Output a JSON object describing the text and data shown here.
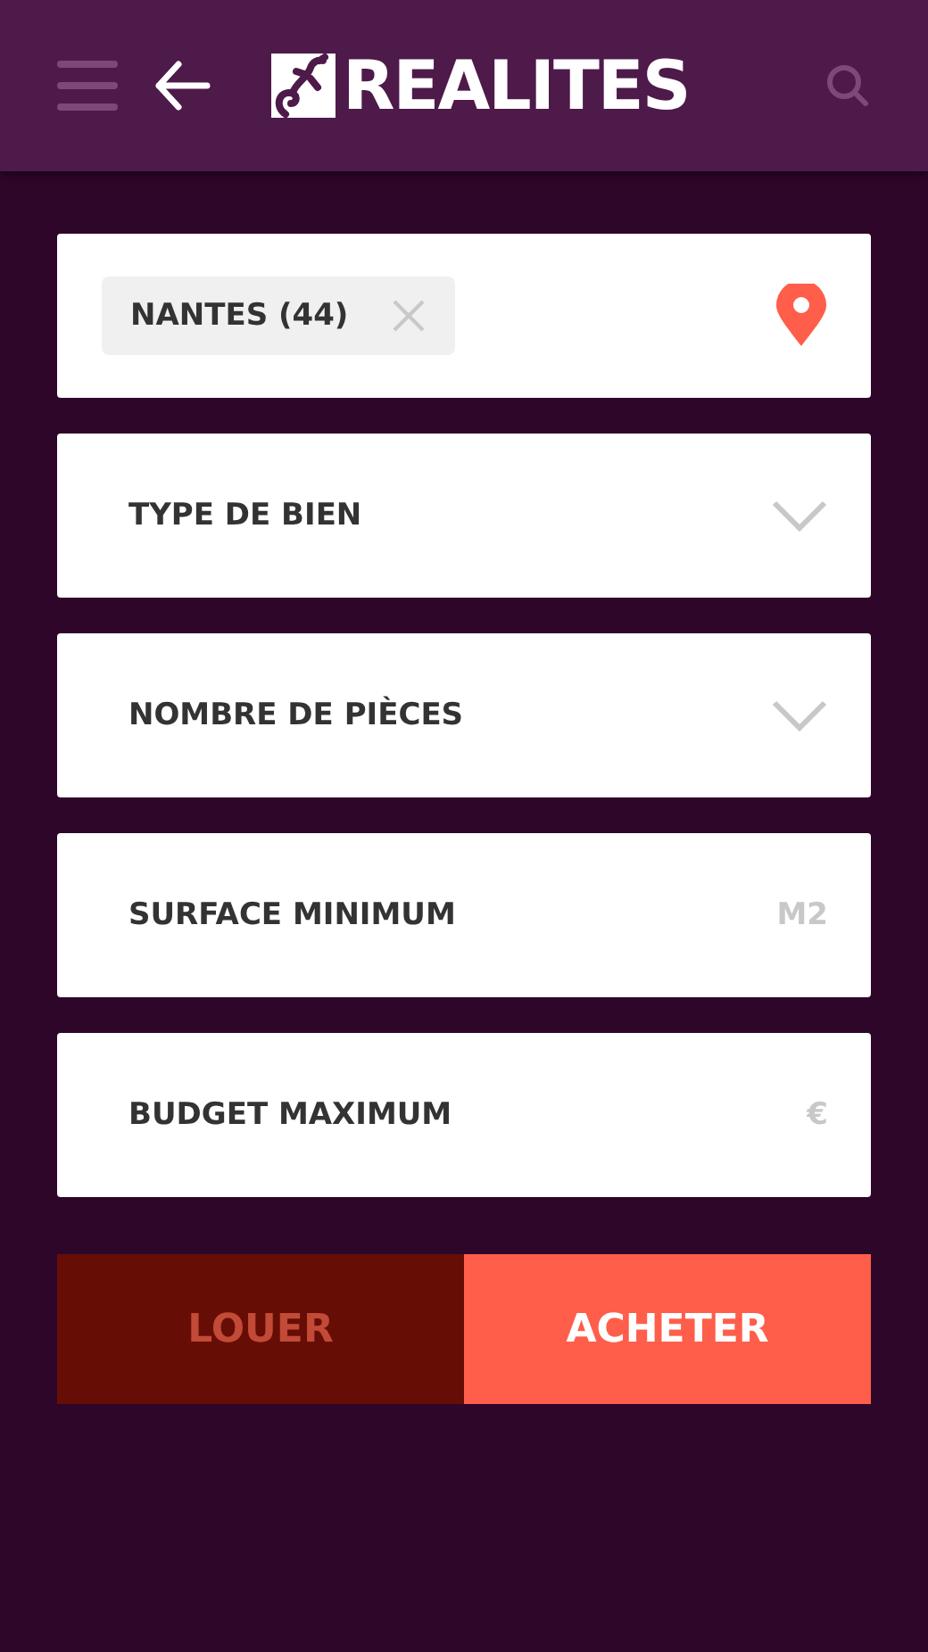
{
  "header": {
    "logo": "REALITES"
  },
  "fields": [
    {
      "kind": "chip",
      "value": "NANTES (44)"
    },
    {
      "kind": "select",
      "label": "TYPE DE BIEN"
    },
    {
      "kind": "select",
      "label": "NOMBRE DE PIÈCES"
    },
    {
      "kind": "unit",
      "label": "SURFACE MINIMUM",
      "unit": "M2"
    },
    {
      "kind": "unit",
      "label": "BUDGET MAXIMUM",
      "unit": "€"
    }
  ],
  "modes": [
    {
      "label": "LOUER",
      "selected": false
    },
    {
      "label": "ACHETER",
      "selected": true
    }
  ]
}
